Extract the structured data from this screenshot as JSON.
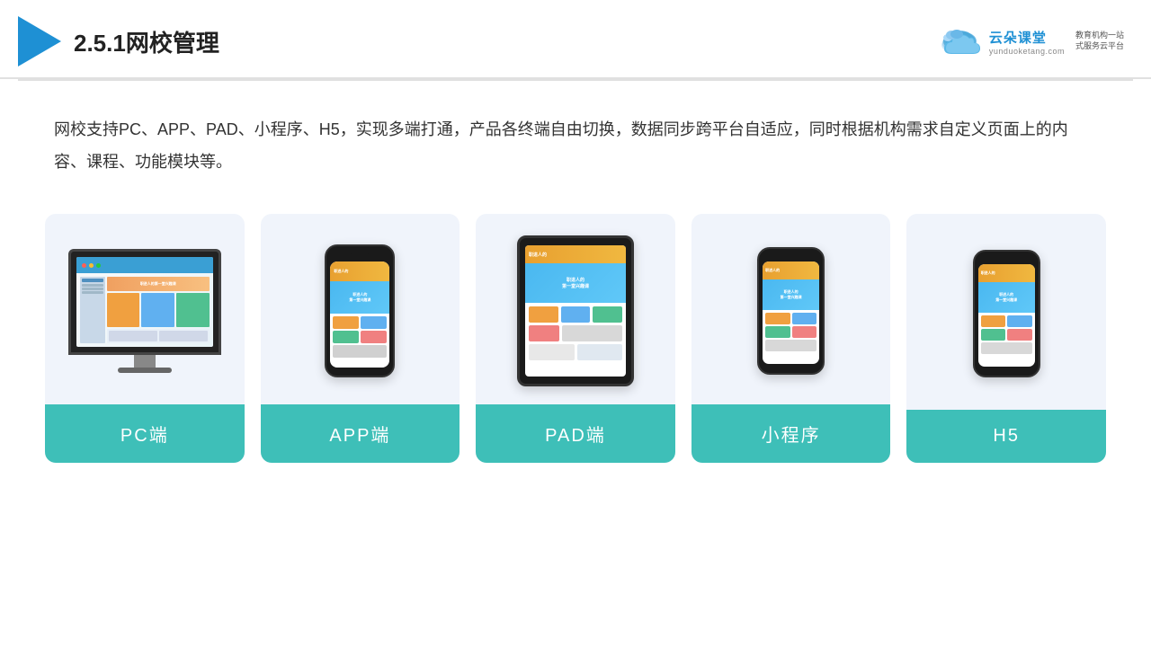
{
  "header": {
    "title": "2.5.1网校管理",
    "title_number": "2.5.1",
    "title_text": "网校管理"
  },
  "brand": {
    "name": "云朵课堂",
    "domain": "yunduoketang.com",
    "slogan": "教育机构一站\n式服务云平台"
  },
  "description": {
    "text": "网校支持PC、APP、PAD、小程序、H5，实现多端打通，产品各终端自由切换，数据同步跨平台自适应，同时根据机构需求自定义页面上的内容、课程、功能模块等。"
  },
  "cards": [
    {
      "id": "pc",
      "label": "PC端"
    },
    {
      "id": "app",
      "label": "APP端"
    },
    {
      "id": "pad",
      "label": "PAD端"
    },
    {
      "id": "miniprogram",
      "label": "小程序"
    },
    {
      "id": "h5",
      "label": "H5"
    }
  ]
}
